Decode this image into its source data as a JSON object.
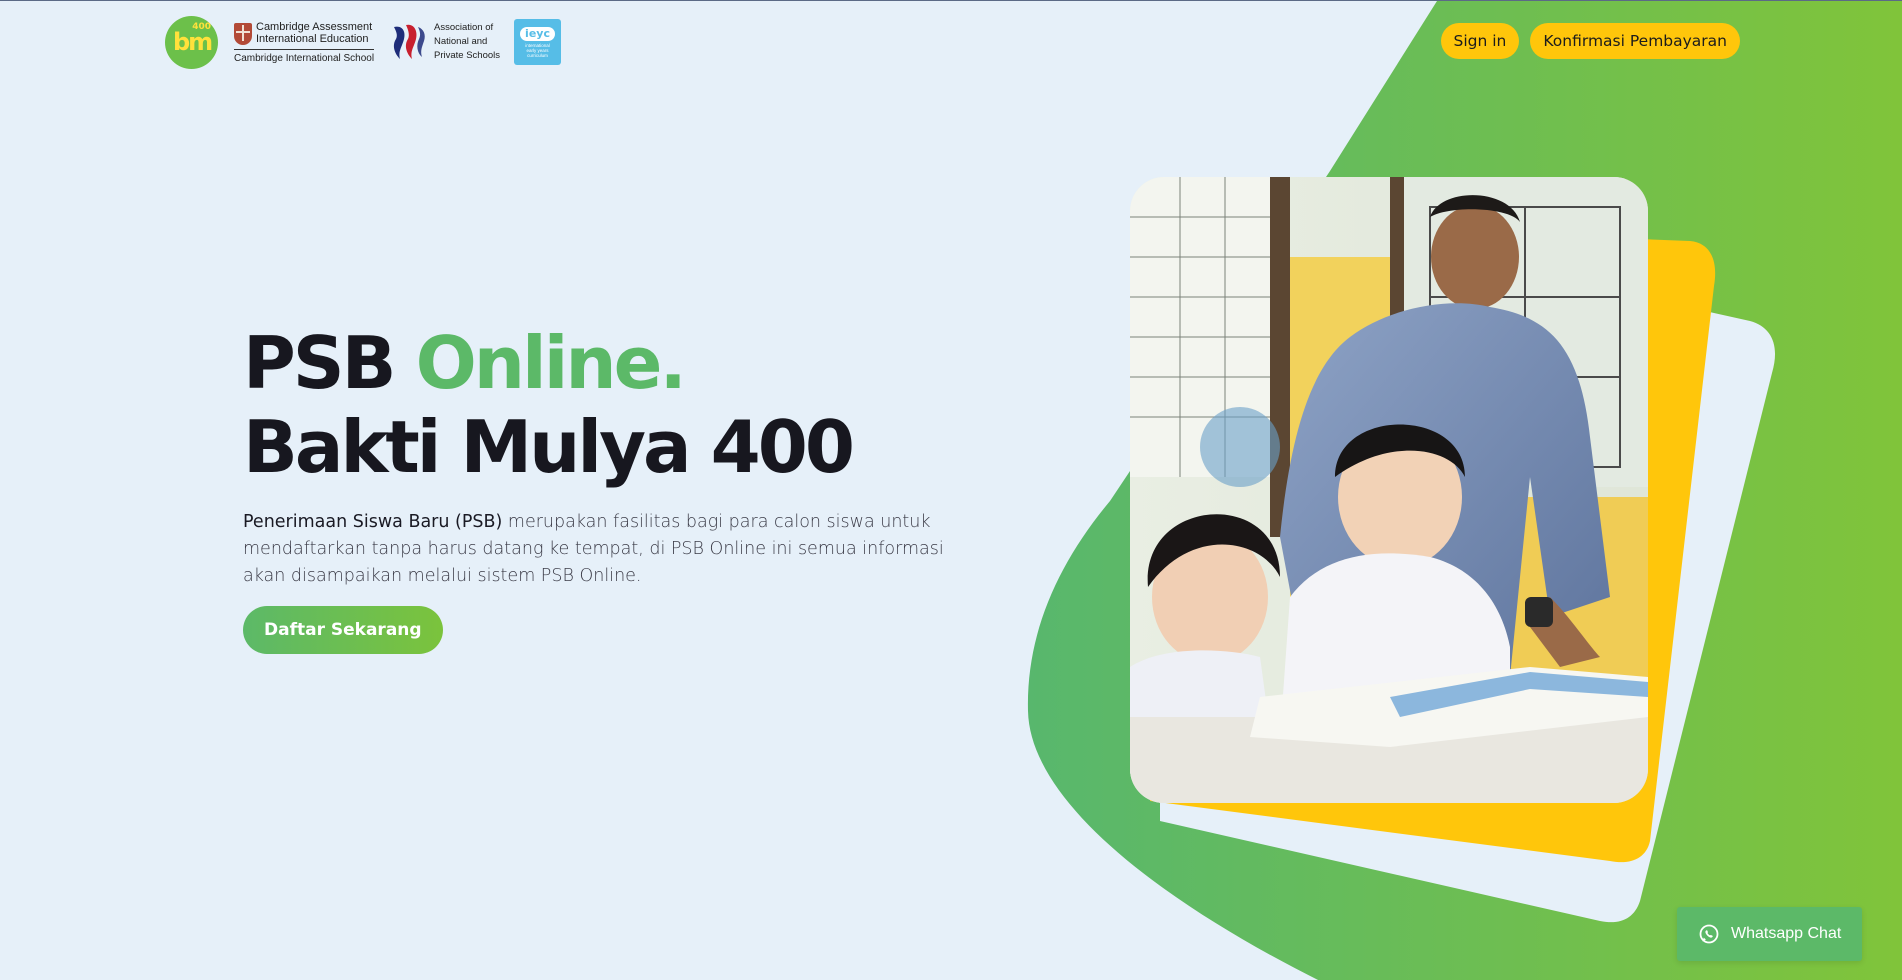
{
  "header": {
    "logos": {
      "bm": {
        "text": "bm",
        "number": "400"
      },
      "cambridge": {
        "line1": "Cambridge Assessment",
        "line2": "International Education",
        "sub": "Cambridge International School"
      },
      "anps": {
        "line1": "Association of",
        "line2": "National and",
        "line3": "Private Schools"
      },
      "ieyc": {
        "badge": "ieyc",
        "line1": "international",
        "line2": "early years",
        "line3": "curriculum"
      }
    },
    "nav": {
      "sign_in": "Sign in",
      "confirm_payment": "Konfirmasi Pembayaran"
    }
  },
  "hero": {
    "title_part1": "PSB",
    "title_accent": "Online.",
    "title_line2": "Bakti Mulya 400",
    "desc_strong": "Penerimaan Siswa Baru (PSB)",
    "desc_rest": " merupakan fasilitas bagi para calon siswa untuk mendaftarkan tanpa harus datang ke tempat, di PSB Online ini semua informasi akan disampaikan melalui sistem PSB Online.",
    "cta_label": "Daftar Sekarang"
  },
  "whatsapp": {
    "label": "Whatsapp Chat"
  },
  "colors": {
    "background": "#e6f0f9",
    "green": "#5cb968",
    "lime": "#7bc33c",
    "yellow": "#ffc60b",
    "dark_text": "#17171f"
  },
  "photo": {
    "subject": "teacher-with-students-photo"
  }
}
